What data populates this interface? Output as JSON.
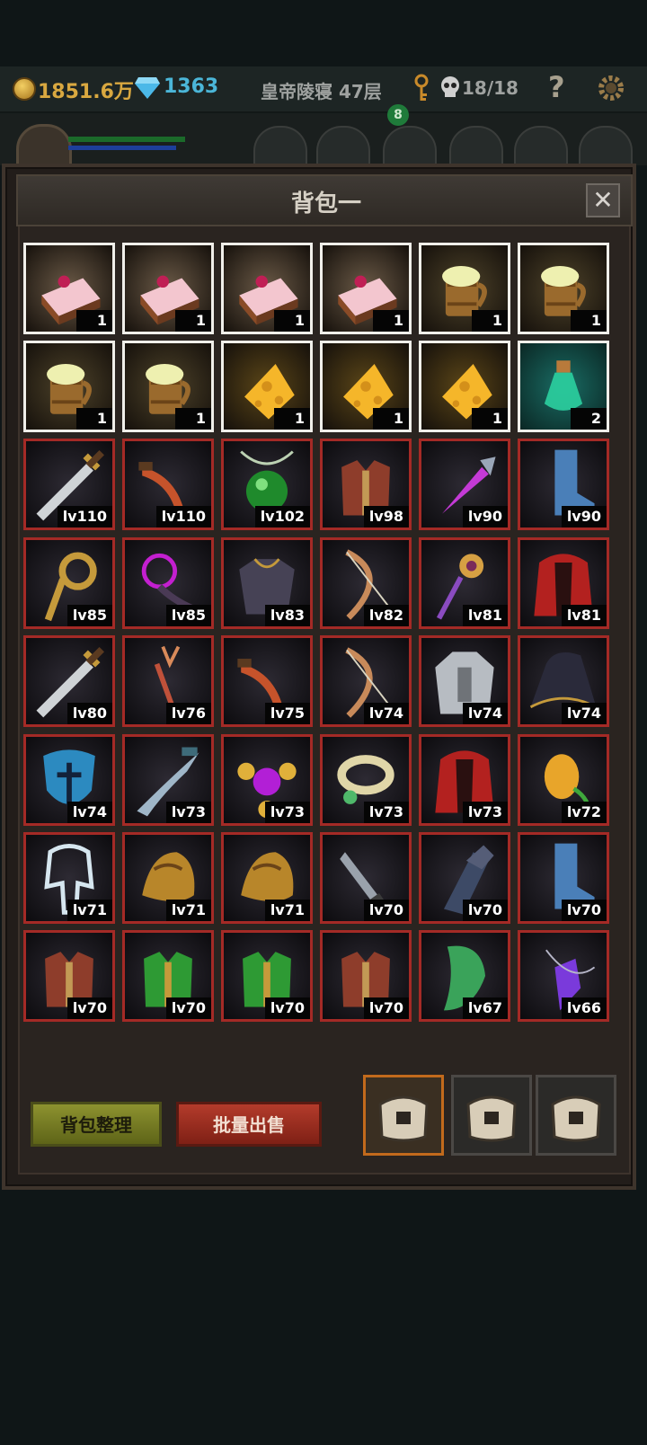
{
  "topbar": {
    "gold": "1851.6万",
    "gems": "1363",
    "floor": "皇帝陵寝 47层",
    "skulls": "18/18",
    "help": "?",
    "badge": "8"
  },
  "panel": {
    "title": "背包一",
    "close": "✕"
  },
  "buttons": {
    "sort": "背包整理",
    "sell": "批量出售"
  },
  "consumables": [
    {
      "name": "cake",
      "count": "1"
    },
    {
      "name": "cake",
      "count": "1"
    },
    {
      "name": "cake",
      "count": "1"
    },
    {
      "name": "cake",
      "count": "1"
    },
    {
      "name": "ale-mug",
      "count": "1"
    },
    {
      "name": "ale-mug",
      "count": "1"
    },
    {
      "name": "ale-mug",
      "count": "1"
    },
    {
      "name": "ale-mug",
      "count": "1"
    },
    {
      "name": "cheese",
      "count": "1"
    },
    {
      "name": "cheese",
      "count": "1"
    },
    {
      "name": "cheese",
      "count": "1"
    },
    {
      "name": "potion",
      "count": "2"
    }
  ],
  "equipment": [
    {
      "name": "sword",
      "level": "lv110"
    },
    {
      "name": "dagger",
      "level": "lv110"
    },
    {
      "name": "amulet",
      "level": "lv102"
    },
    {
      "name": "vest",
      "level": "lv98"
    },
    {
      "name": "claw",
      "level": "lv90"
    },
    {
      "name": "boot",
      "level": "lv90"
    },
    {
      "name": "horn-staff",
      "level": "lv85"
    },
    {
      "name": "dark-orb",
      "level": "lv85"
    },
    {
      "name": "armor",
      "level": "lv83"
    },
    {
      "name": "bow",
      "level": "lv82"
    },
    {
      "name": "eye-staff",
      "level": "lv81"
    },
    {
      "name": "cape",
      "level": "lv81"
    },
    {
      "name": "sword",
      "level": "lv80"
    },
    {
      "name": "trident",
      "level": "lv76"
    },
    {
      "name": "dagger",
      "level": "lv75"
    },
    {
      "name": "bow",
      "level": "lv74"
    },
    {
      "name": "plate-armor",
      "level": "lv74"
    },
    {
      "name": "hat",
      "level": "lv74"
    },
    {
      "name": "shield",
      "level": "lv74"
    },
    {
      "name": "blade",
      "level": "lv73"
    },
    {
      "name": "necklace",
      "level": "lv73"
    },
    {
      "name": "ring",
      "level": "lv73"
    },
    {
      "name": "cape",
      "level": "lv73"
    },
    {
      "name": "seed",
      "level": "lv72"
    },
    {
      "name": "ghost-hood",
      "level": "lv71"
    },
    {
      "name": "pauldron",
      "level": "lv71"
    },
    {
      "name": "pauldron",
      "level": "lv71"
    },
    {
      "name": "knife",
      "level": "lv70"
    },
    {
      "name": "gauntlet",
      "level": "lv70"
    },
    {
      "name": "boot",
      "level": "lv70"
    },
    {
      "name": "vest",
      "level": "lv70"
    },
    {
      "name": "green-vest",
      "level": "lv70"
    },
    {
      "name": "green-vest",
      "level": "lv70"
    },
    {
      "name": "vest",
      "level": "lv70"
    },
    {
      "name": "green-cloak",
      "level": "lv67"
    },
    {
      "name": "crystal",
      "level": "lv66"
    }
  ]
}
